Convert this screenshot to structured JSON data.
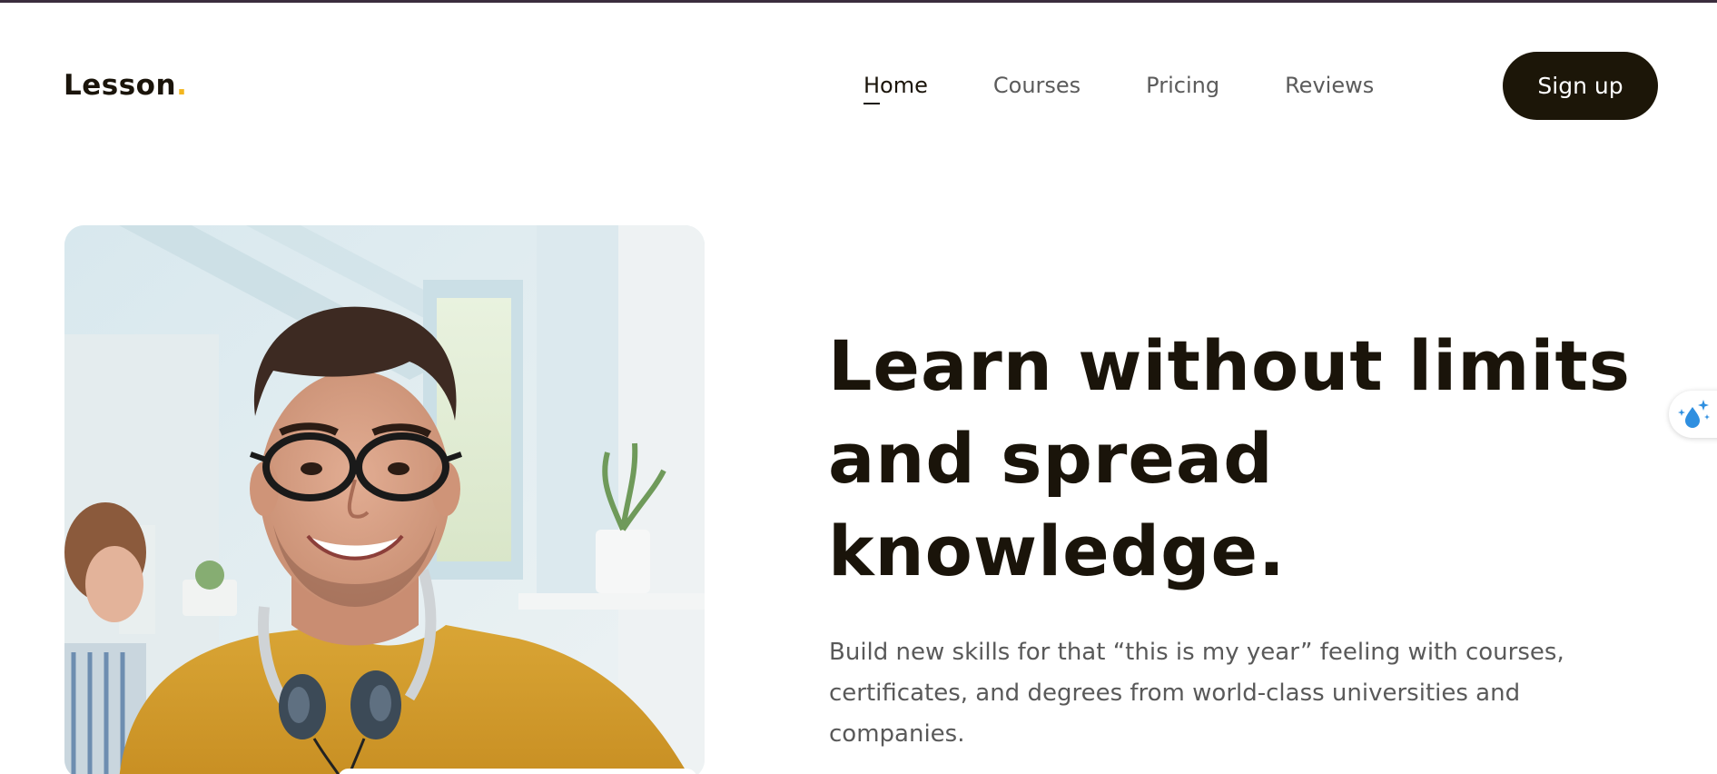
{
  "brand": {
    "name": "Lesson",
    "dot": ".",
    "accent_color": "#f3b61f",
    "text_color": "#1a140a"
  },
  "nav": {
    "items": [
      {
        "label": "Home",
        "active": true
      },
      {
        "label": "Courses",
        "active": false
      },
      {
        "label": "Pricing",
        "active": false
      },
      {
        "label": "Reviews",
        "active": false
      }
    ]
  },
  "header": {
    "signup_label": "Sign up",
    "signup_bg": "#1c1608"
  },
  "hero": {
    "title_line1": "Learn without limits",
    "title_line2": "and spread",
    "title_line3": "knowledge.",
    "subtitle": "Build new skills for that “this is my year” feeling with courses, certificates, and degrees from world-class universities and companies.",
    "image_subject": "smiling-student-with-headphones-photo"
  },
  "side_widget": {
    "icon": "sparkle-drop-icon",
    "icon_color": "#2f8fe0"
  }
}
